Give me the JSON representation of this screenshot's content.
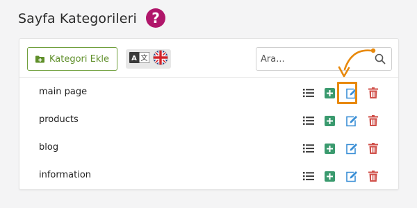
{
  "header": {
    "title": "Sayfa Kategorileri",
    "help_symbol": "?"
  },
  "toolbar": {
    "add_category_label": "Kategori Ekle",
    "language_icon": "translate-icon",
    "language_flag": "uk-flag-icon",
    "search_placeholder": "Ara..."
  },
  "categories": [
    {
      "label": "main page"
    },
    {
      "label": "products"
    },
    {
      "label": "blog"
    },
    {
      "label": "information"
    }
  ],
  "row_actions": [
    "list-icon",
    "plus-square-icon",
    "edit-icon",
    "trash-icon"
  ],
  "colors": {
    "accent_green": "#5f8f2a",
    "action_green": "#3a9a6e",
    "action_blue": "#3b8fd6",
    "action_red": "#d0504a",
    "help_magenta": "#b0166a",
    "highlight_orange": "#e8890c"
  }
}
